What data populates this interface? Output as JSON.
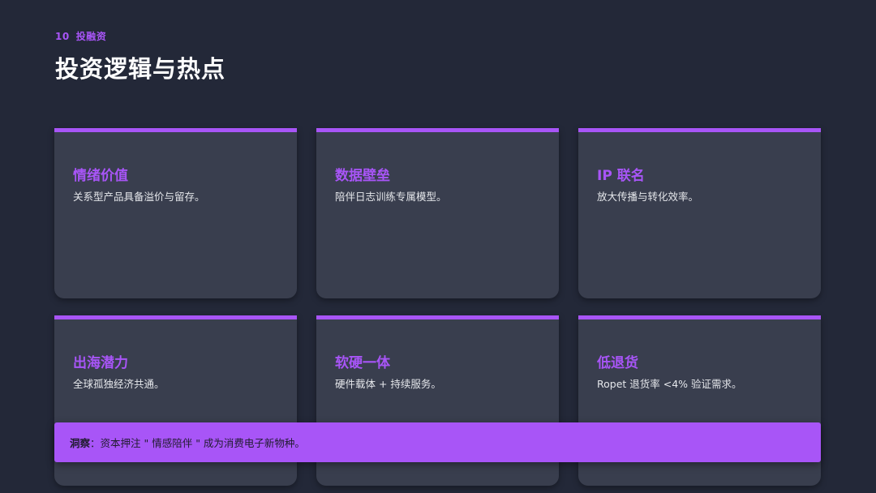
{
  "header": {
    "section_number": "10",
    "section_name": "投融资",
    "title": "投资逻辑与热点"
  },
  "cards": [
    {
      "title": "情绪价值",
      "desc": "关系型产品具备溢价与留存。"
    },
    {
      "title": "数据壁垒",
      "desc": "陪伴日志训练专属模型。"
    },
    {
      "title": "IP 联名",
      "desc": "放大传播与转化效率。"
    },
    {
      "title": "出海潜力",
      "desc": "全球孤独经济共通。"
    },
    {
      "title": "软硬一体",
      "desc": "硬件载体 + 持续服务。"
    },
    {
      "title": "低退货",
      "desc": "Ropet 退货率 <4% 验证需求。"
    }
  ],
  "insight": {
    "label": "洞察",
    "separator": "：",
    "text": "资本押注 \" 情感陪伴 \" 成为消费电子新物种。"
  },
  "colors": {
    "background": "#232838",
    "card": "#393e4e",
    "accent": "#a855f7",
    "title_text": "#ffffff",
    "body_text": "#e5e7eb"
  }
}
